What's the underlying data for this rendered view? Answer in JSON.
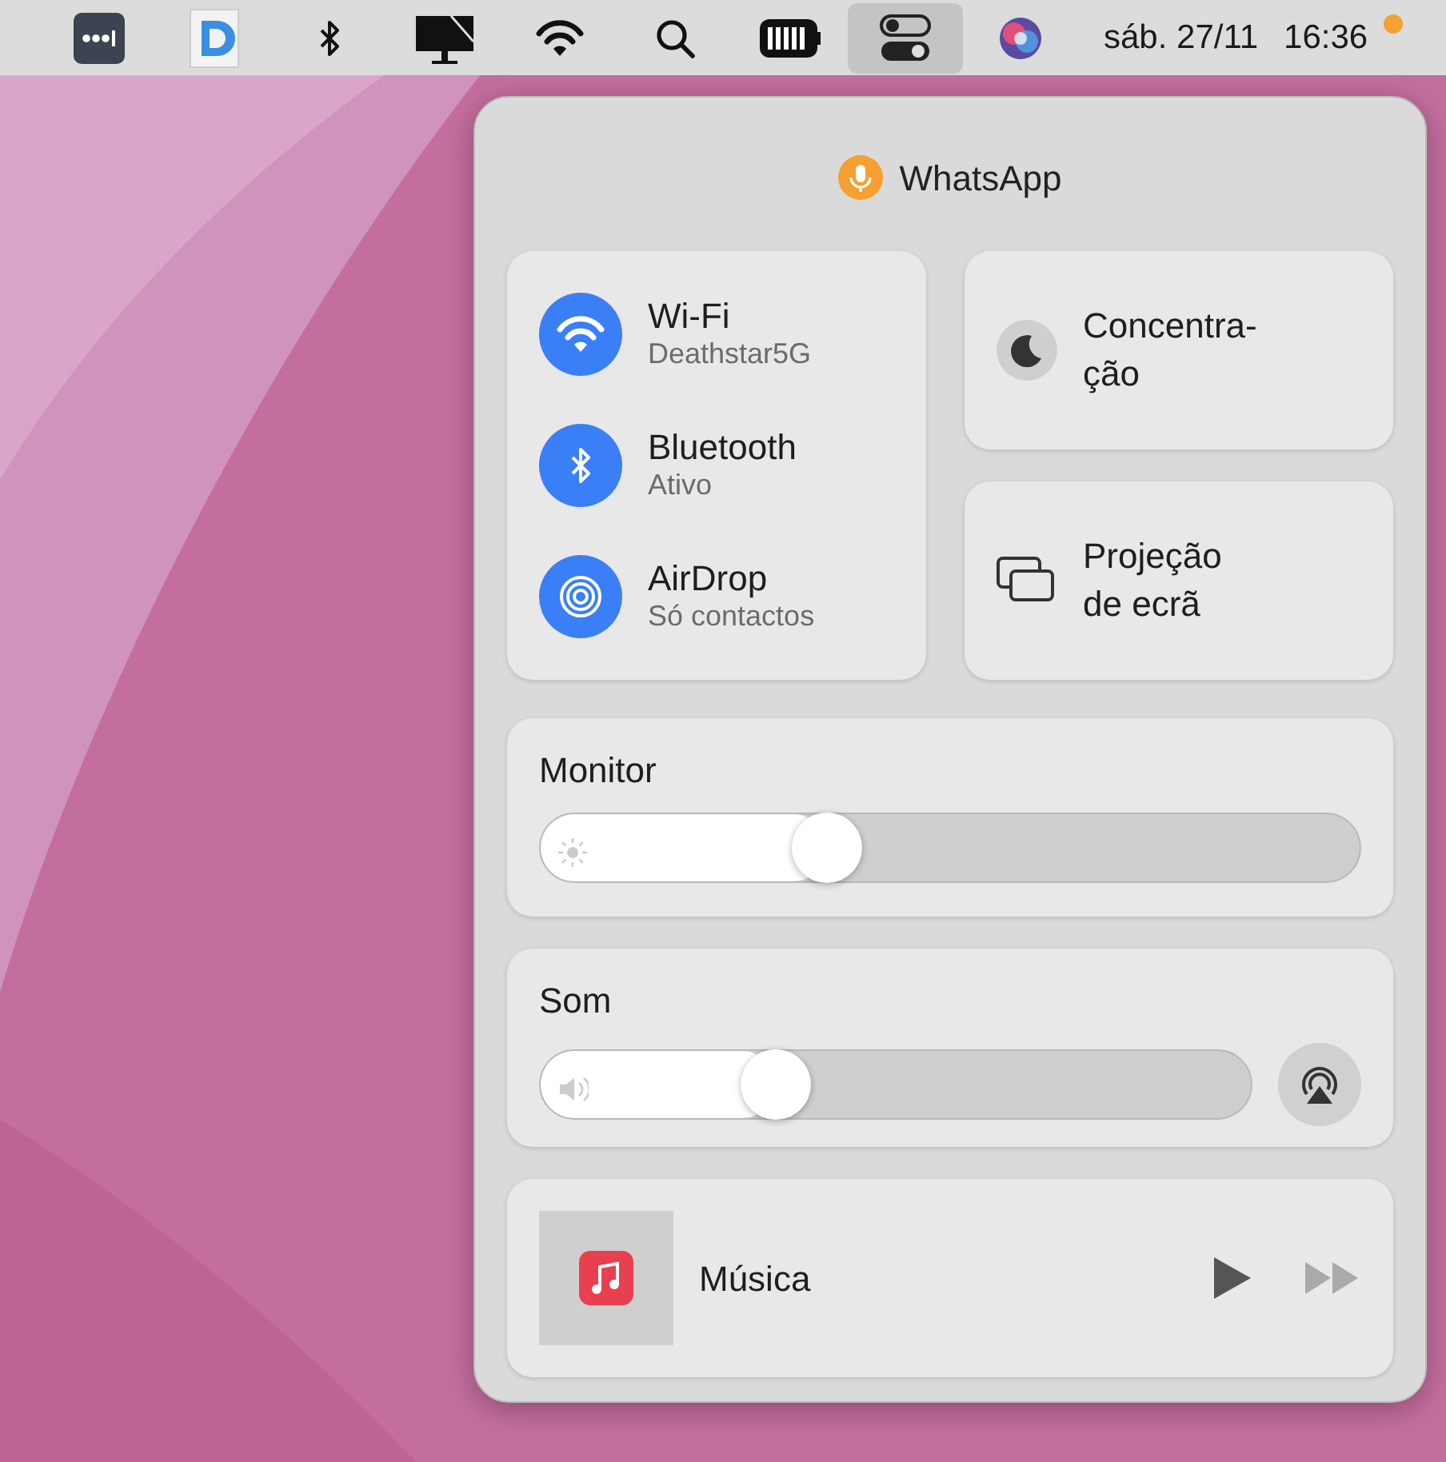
{
  "menu_bar": {
    "date": "sáb. 27/11",
    "time": "16:36"
  },
  "panel": {
    "mic_app": "WhatsApp",
    "connectivity": [
      {
        "kind": "wifi",
        "label": "Wi-Fi",
        "status": "Deathstar5G",
        "on": true
      },
      {
        "kind": "bluetooth",
        "label": "Bluetooth",
        "status": "Ativo",
        "on": true
      },
      {
        "kind": "airdrop",
        "label": "AirDrop",
        "status": "Só contactos",
        "on": true
      }
    ],
    "tiles": [
      {
        "kind": "focus",
        "lines": [
          "Concentra-",
          "ção"
        ]
      },
      {
        "kind": "mirroring",
        "lines": [
          "Projeção",
          "de ecrã"
        ]
      }
    ],
    "sliders": [
      {
        "kind": "display",
        "title": "Monitor",
        "level": 0.35
      },
      {
        "kind": "sound",
        "title": "Som",
        "level": 0.33
      }
    ],
    "now_playing": {
      "app": "Música"
    }
  }
}
